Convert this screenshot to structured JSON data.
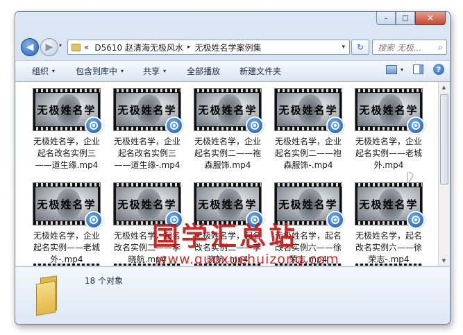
{
  "window": {
    "minimize": "–",
    "maximize": "□",
    "close": "✕"
  },
  "nav": {
    "back_icon": "arrow-left-icon",
    "forward_icon": "arrow-right-icon",
    "history": "▾",
    "address": {
      "prefix": "«",
      "crumb1": "D5610 赵清海无极风水",
      "sep": "▸",
      "crumb2": "无极姓名学案例集",
      "dropdown": "▾"
    },
    "refresh": "↻",
    "search_placeholder": "搜索 无极...",
    "search_icon": "⌕"
  },
  "toolbar": {
    "organize": "组织",
    "include": "包含到库中",
    "share": "共享",
    "playall": "全部播放",
    "newfolder": "新建文件夹",
    "arrow": "▾",
    "help": "?"
  },
  "thumb_text": "无极姓名学",
  "files": [
    {
      "name": "无极姓名学，企业起名改名实例三——道生缘.mp4"
    },
    {
      "name": "无极姓名学，企业起名改名实例三——道生缘-.mp4"
    },
    {
      "name": "无极姓名学，企业起名实例二——袍森服饰.mp4"
    },
    {
      "name": "无极姓名学，企业起名实例二——袍森服饰-.mp4"
    },
    {
      "name": "无极姓名学，企业起名实例——老城外.mp4"
    },
    {
      "name": "无极姓名学，企业起名实例——老城外-.mp4"
    },
    {
      "name": "无极姓名学，起名改名实例二——李晓航.mp4"
    },
    {
      "name": "无极姓名学，起名改名实例二——李晓航-.mp4"
    },
    {
      "name": "无极姓名学，起名改名实例六——徐荣志.mp4"
    },
    {
      "name": "无极姓名学，起名改名实例六——徐荣志-.mp4"
    }
  ],
  "watermark": {
    "text": "国学汇总站",
    "url": "www.guoxuehuizong.com"
  },
  "status": {
    "count": "18 个对象"
  },
  "scroll": {
    "up": "▲",
    "down": "▼"
  }
}
